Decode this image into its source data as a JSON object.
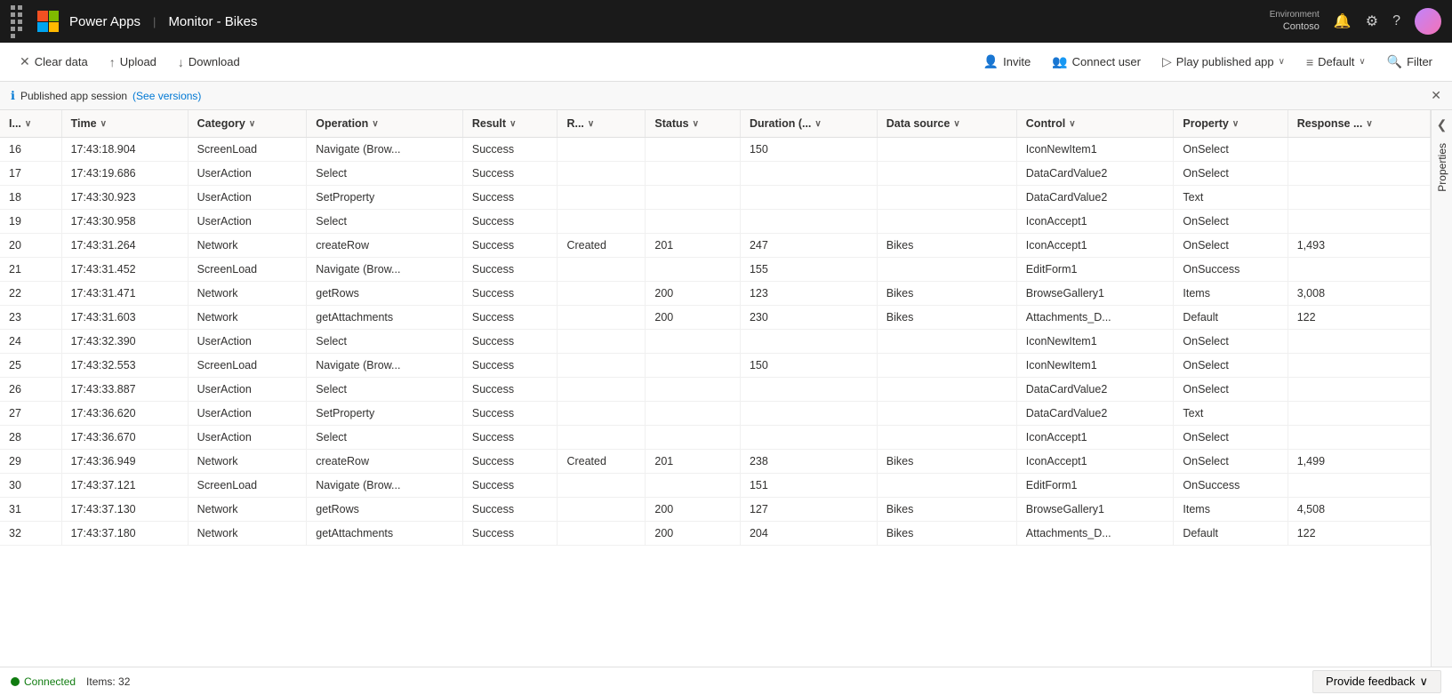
{
  "topbar": {
    "app_name": "Power Apps",
    "separator": "|",
    "context": "Monitor - Bikes",
    "environment_label": "Environment",
    "environment_name": "Contoso"
  },
  "toolbar": {
    "clear_data": "Clear data",
    "upload": "Upload",
    "download": "Download",
    "invite": "Invite",
    "connect_user": "Connect user",
    "play_published_app": "Play published app",
    "default": "Default",
    "filter": "Filter"
  },
  "info_bar": {
    "message": "Published app session",
    "link_text": "(See versions)"
  },
  "columns": [
    {
      "id": "id",
      "label": "I..."
    },
    {
      "id": "time",
      "label": "Time"
    },
    {
      "id": "category",
      "label": "Category"
    },
    {
      "id": "operation",
      "label": "Operation"
    },
    {
      "id": "result",
      "label": "Result"
    },
    {
      "id": "r",
      "label": "R..."
    },
    {
      "id": "status",
      "label": "Status"
    },
    {
      "id": "duration",
      "label": "Duration (..."
    },
    {
      "id": "datasource",
      "label": "Data source"
    },
    {
      "id": "control",
      "label": "Control"
    },
    {
      "id": "property",
      "label": "Property"
    },
    {
      "id": "response",
      "label": "Response ..."
    }
  ],
  "rows": [
    {
      "id": "16",
      "time": "17:43:18.904",
      "category": "ScreenLoad",
      "operation": "Navigate (Brow...",
      "result": "Success",
      "r": "",
      "status": "",
      "duration": "150",
      "datasource": "",
      "control": "IconNewItem1",
      "property": "OnSelect",
      "response": ""
    },
    {
      "id": "17",
      "time": "17:43:19.686",
      "category": "UserAction",
      "operation": "Select",
      "result": "Success",
      "r": "",
      "status": "",
      "duration": "",
      "datasource": "",
      "control": "DataCardValue2",
      "property": "OnSelect",
      "response": ""
    },
    {
      "id": "18",
      "time": "17:43:30.923",
      "category": "UserAction",
      "operation": "SetProperty",
      "result": "Success",
      "r": "",
      "status": "",
      "duration": "",
      "datasource": "",
      "control": "DataCardValue2",
      "property": "Text",
      "response": ""
    },
    {
      "id": "19",
      "time": "17:43:30.958",
      "category": "UserAction",
      "operation": "Select",
      "result": "Success",
      "r": "",
      "status": "",
      "duration": "",
      "datasource": "",
      "control": "IconAccept1",
      "property": "OnSelect",
      "response": ""
    },
    {
      "id": "20",
      "time": "17:43:31.264",
      "category": "Network",
      "operation": "createRow",
      "result": "Success",
      "r": "Created",
      "status": "201",
      "duration": "247",
      "datasource": "Bikes",
      "control": "IconAccept1",
      "property": "OnSelect",
      "response": "1,493"
    },
    {
      "id": "21",
      "time": "17:43:31.452",
      "category": "ScreenLoad",
      "operation": "Navigate (Brow...",
      "result": "Success",
      "r": "",
      "status": "",
      "duration": "155",
      "datasource": "",
      "control": "EditForm1",
      "property": "OnSuccess",
      "response": ""
    },
    {
      "id": "22",
      "time": "17:43:31.471",
      "category": "Network",
      "operation": "getRows",
      "result": "Success",
      "r": "",
      "status": "200",
      "duration": "123",
      "datasource": "Bikes",
      "control": "BrowseGallery1",
      "property": "Items",
      "response": "3,008"
    },
    {
      "id": "23",
      "time": "17:43:31.603",
      "category": "Network",
      "operation": "getAttachments",
      "result": "Success",
      "r": "",
      "status": "200",
      "duration": "230",
      "datasource": "Bikes",
      "control": "Attachments_D...",
      "property": "Default",
      "response": "122"
    },
    {
      "id": "24",
      "time": "17:43:32.390",
      "category": "UserAction",
      "operation": "Select",
      "result": "Success",
      "r": "",
      "status": "",
      "duration": "",
      "datasource": "",
      "control": "IconNewItem1",
      "property": "OnSelect",
      "response": ""
    },
    {
      "id": "25",
      "time": "17:43:32.553",
      "category": "ScreenLoad",
      "operation": "Navigate (Brow...",
      "result": "Success",
      "r": "",
      "status": "",
      "duration": "150",
      "datasource": "",
      "control": "IconNewItem1",
      "property": "OnSelect",
      "response": ""
    },
    {
      "id": "26",
      "time": "17:43:33.887",
      "category": "UserAction",
      "operation": "Select",
      "result": "Success",
      "r": "",
      "status": "",
      "duration": "",
      "datasource": "",
      "control": "DataCardValue2",
      "property": "OnSelect",
      "response": ""
    },
    {
      "id": "27",
      "time": "17:43:36.620",
      "category": "UserAction",
      "operation": "SetProperty",
      "result": "Success",
      "r": "",
      "status": "",
      "duration": "",
      "datasource": "",
      "control": "DataCardValue2",
      "property": "Text",
      "response": ""
    },
    {
      "id": "28",
      "time": "17:43:36.670",
      "category": "UserAction",
      "operation": "Select",
      "result": "Success",
      "r": "",
      "status": "",
      "duration": "",
      "datasource": "",
      "control": "IconAccept1",
      "property": "OnSelect",
      "response": ""
    },
    {
      "id": "29",
      "time": "17:43:36.949",
      "category": "Network",
      "operation": "createRow",
      "result": "Success",
      "r": "Created",
      "status": "201",
      "duration": "238",
      "datasource": "Bikes",
      "control": "IconAccept1",
      "property": "OnSelect",
      "response": "1,499"
    },
    {
      "id": "30",
      "time": "17:43:37.121",
      "category": "ScreenLoad",
      "operation": "Navigate (Brow...",
      "result": "Success",
      "r": "",
      "status": "",
      "duration": "151",
      "datasource": "",
      "control": "EditForm1",
      "property": "OnSuccess",
      "response": ""
    },
    {
      "id": "31",
      "time": "17:43:37.130",
      "category": "Network",
      "operation": "getRows",
      "result": "Success",
      "r": "",
      "status": "200",
      "duration": "127",
      "datasource": "Bikes",
      "control": "BrowseGallery1",
      "property": "Items",
      "response": "4,508"
    },
    {
      "id": "32",
      "time": "17:43:37.180",
      "category": "Network",
      "operation": "getAttachments",
      "result": "Success",
      "r": "",
      "status": "200",
      "duration": "204",
      "datasource": "Bikes",
      "control": "Attachments_D...",
      "property": "Default",
      "response": "122"
    }
  ],
  "properties_panel": {
    "label": "Properties"
  },
  "status_bar": {
    "connected": "Connected",
    "items": "Items: 32",
    "feedback": "Provide feedback"
  }
}
